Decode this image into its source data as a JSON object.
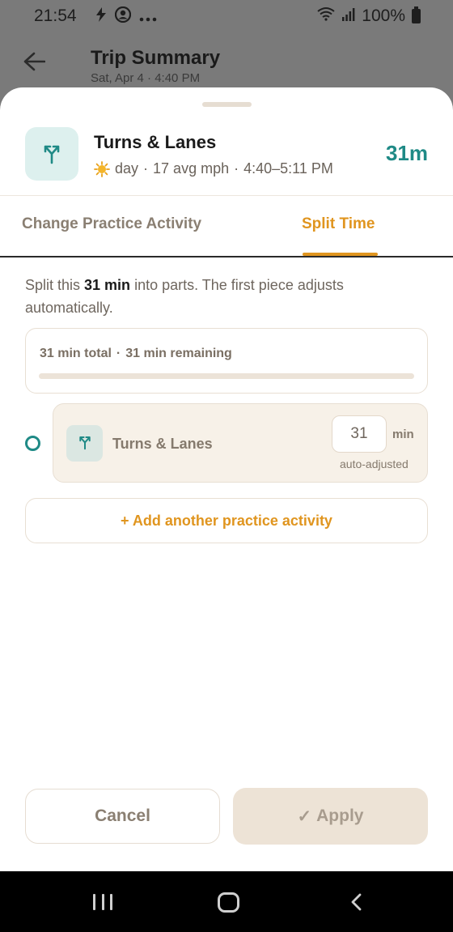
{
  "status_bar": {
    "time": "21:54",
    "battery": "100%"
  },
  "background_page": {
    "title": "Trip Summary",
    "subtitle": "Sat, Apr 4 · 4:40 PM"
  },
  "activity": {
    "name": "Turns & Lanes",
    "condition": "day",
    "condition_icon": "sun-icon",
    "avg_speed": "17 avg mph",
    "time_range": "4:40–5:11 PM",
    "duration": "31m",
    "icon": "turn-arrows-icon"
  },
  "tabs": [
    {
      "label": "Change Practice Activity",
      "active": false
    },
    {
      "label": "Split Time",
      "active": true
    }
  ],
  "intro": {
    "prefix": "Split this ",
    "bold": "31 min",
    "suffix": " into parts. The first piece adjusts automatically."
  },
  "summary": {
    "total": "31 min total",
    "separator": "·",
    "remaining": "31 min remaining",
    "allocated_fraction": 0
  },
  "pieces": [
    {
      "name": "Turns & Lanes",
      "minutes": "31",
      "unit": "min",
      "note": "auto-adjusted"
    }
  ],
  "add_button": {
    "label": "+ Add another practice activity"
  },
  "actions": {
    "cancel": "Cancel",
    "apply_check": "✓",
    "apply": "Apply"
  },
  "colors": {
    "accent": "#e0951f",
    "teal": "#1f8a86",
    "muted": "#8a7f72"
  }
}
